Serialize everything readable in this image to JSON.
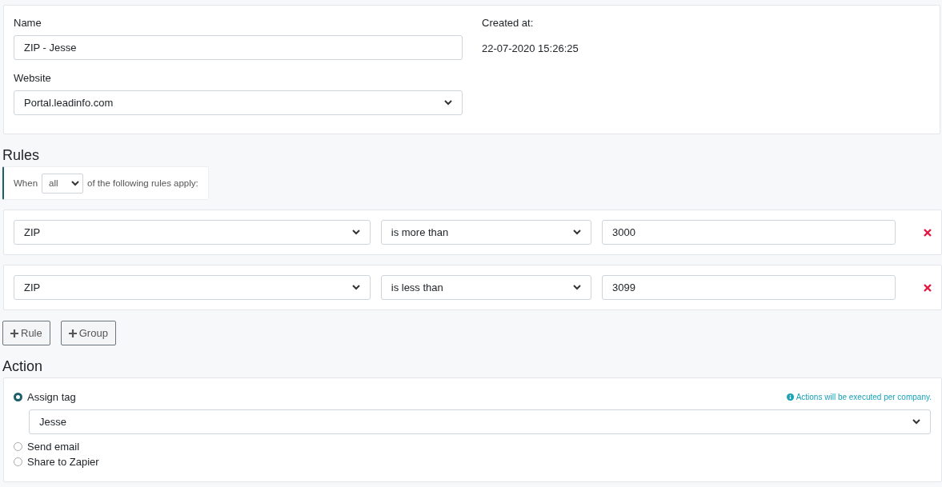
{
  "details": {
    "name": {
      "label": "Name",
      "value": "ZIP - Jesse"
    },
    "created": {
      "label": "Created at:",
      "value": "22-07-2020 15:26:25"
    },
    "website": {
      "label": "Website",
      "value": "Portal.leadinfo.com"
    }
  },
  "rules": {
    "heading": "Rules",
    "condition": {
      "prefix": "When",
      "match": "all",
      "suffix": "of the following rules apply:"
    },
    "items": [
      {
        "field": "ZIP",
        "operator": "is more than",
        "value": "3000"
      },
      {
        "field": "ZIP",
        "operator": "is less than",
        "value": "3099"
      }
    ],
    "buttons": [
      "Rule",
      "Group"
    ]
  },
  "action": {
    "heading": "Action",
    "note": "Actions will be executed per company.",
    "tag": "Jesse",
    "options": [
      {
        "label": "Assign tag",
        "selected": true
      },
      {
        "label": "Send email",
        "selected": false
      },
      {
        "label": "Share to Zapier",
        "selected": false
      }
    ]
  }
}
